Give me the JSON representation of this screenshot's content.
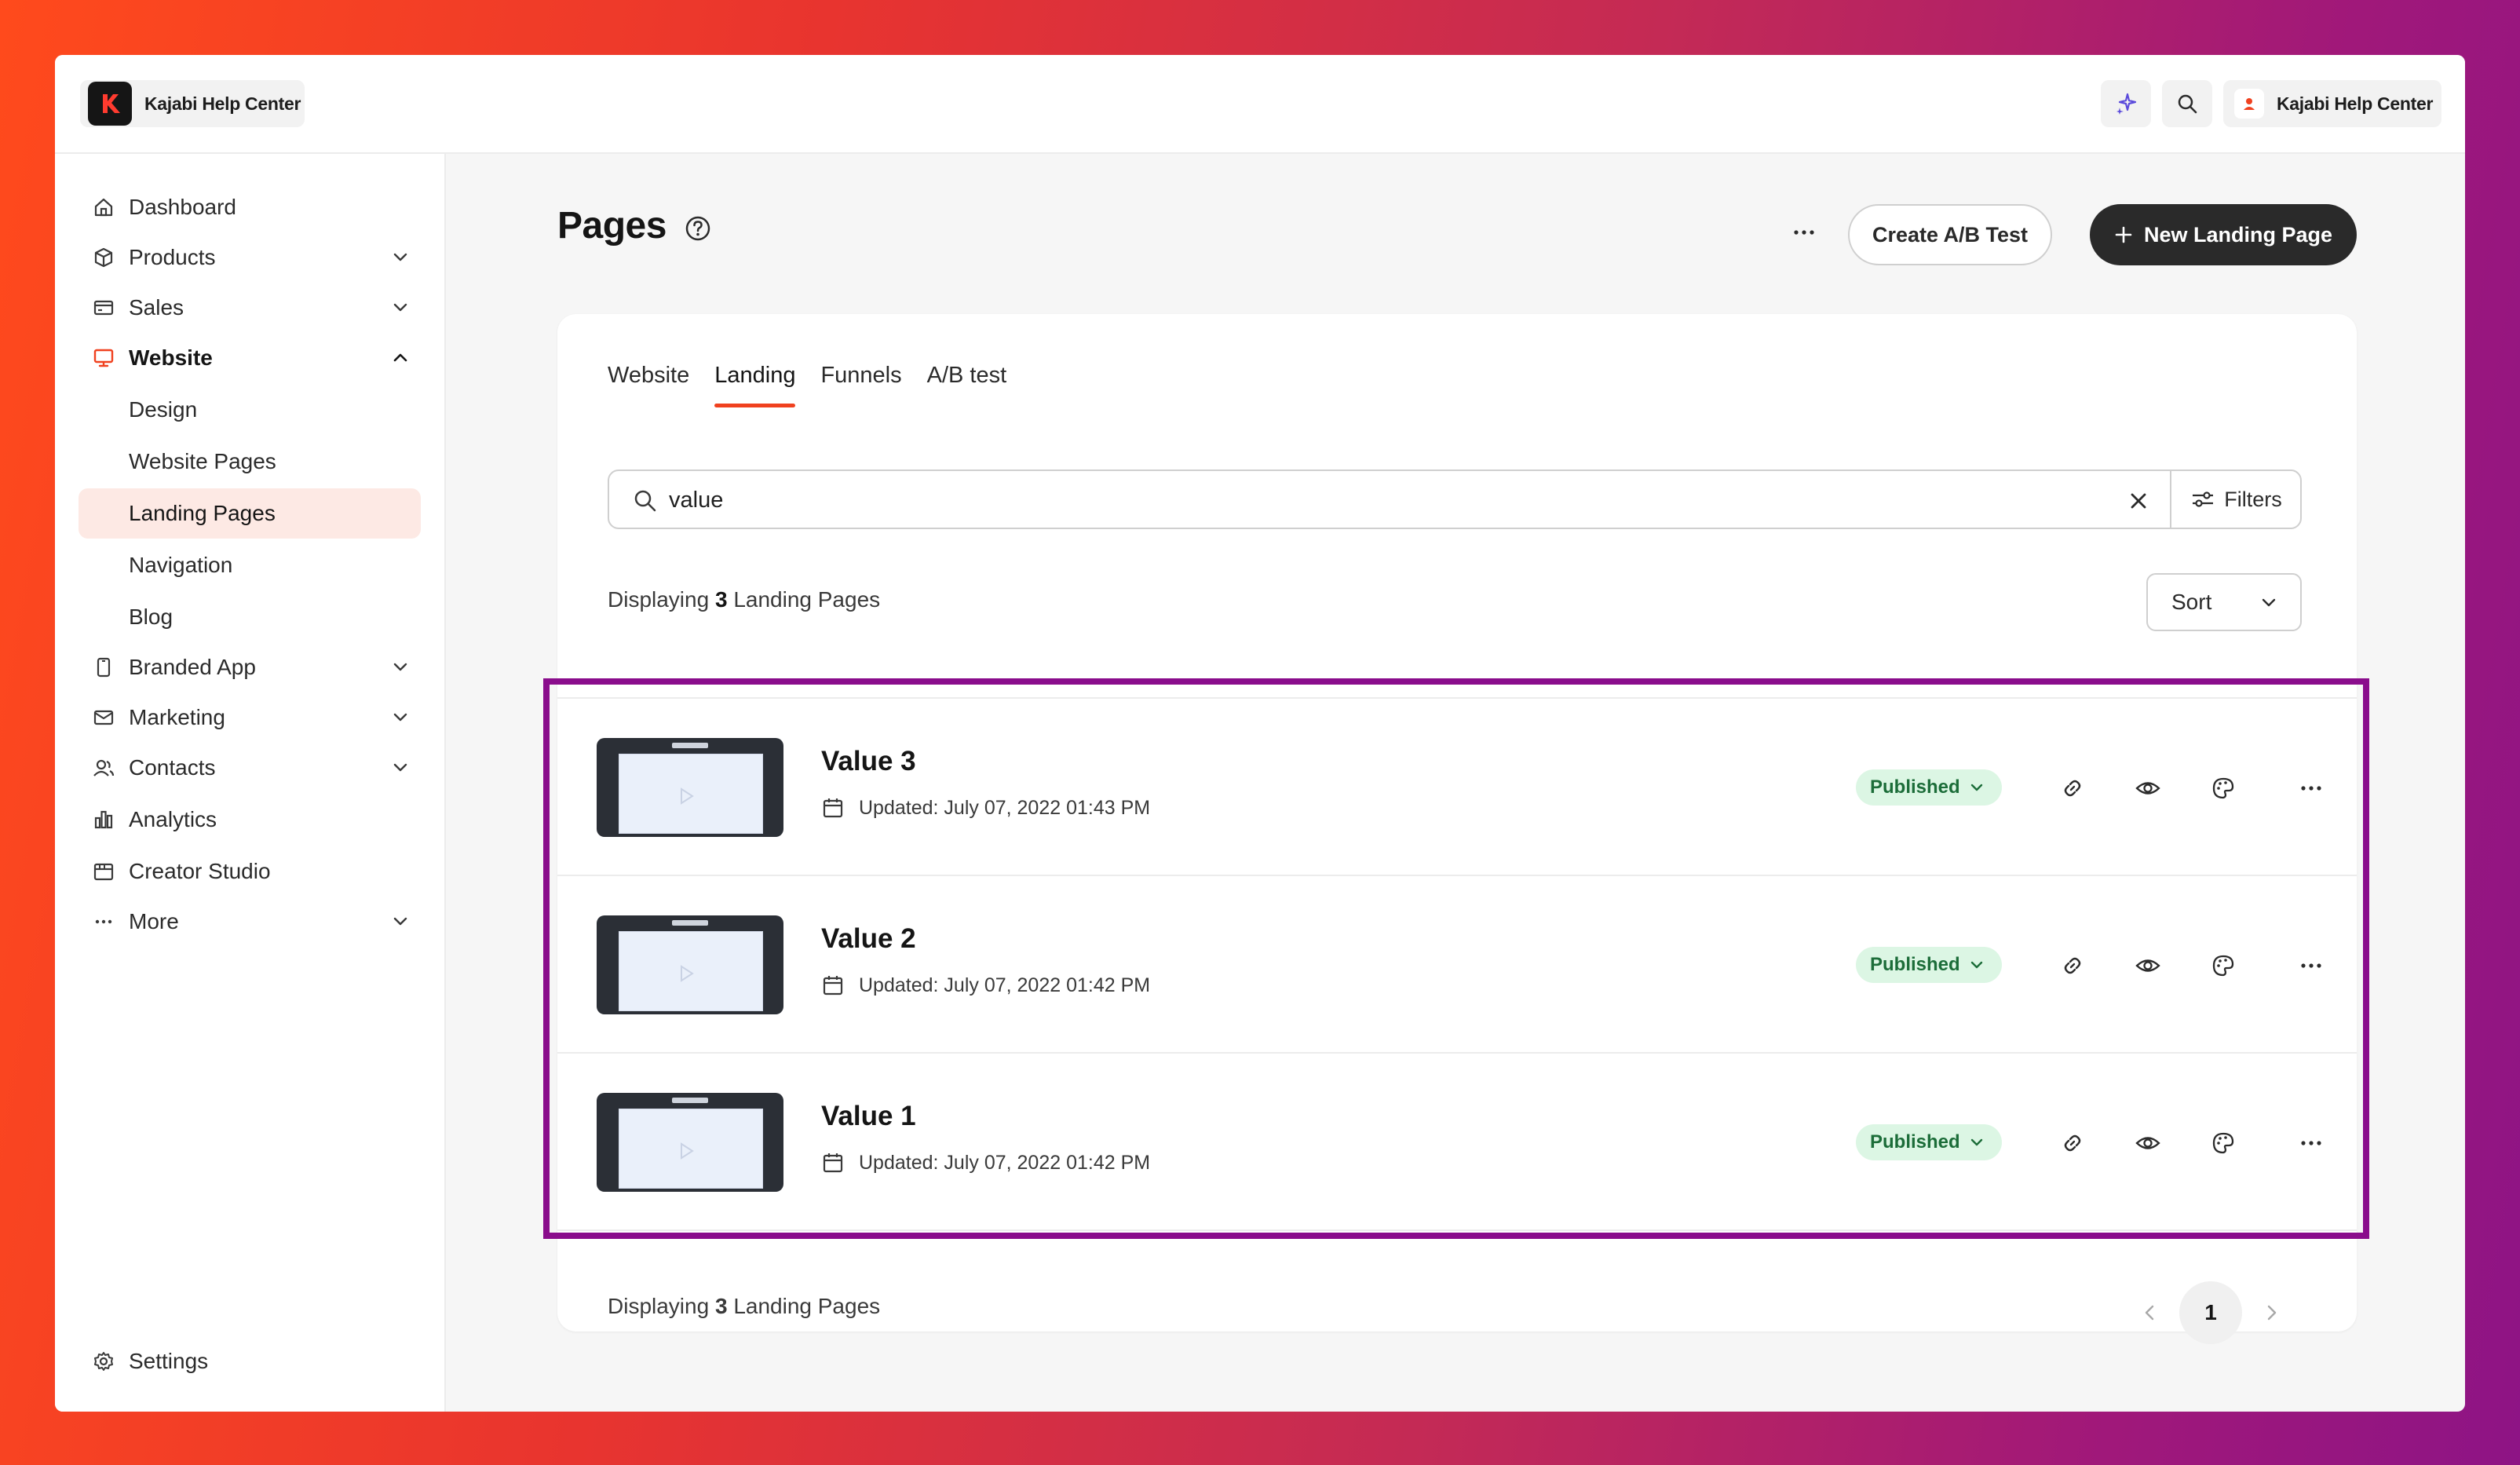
{
  "app": {
    "name": "Kajabi Help Center"
  },
  "header": {
    "user_name": "Kajabi Help Center"
  },
  "sidebar": {
    "items": [
      {
        "label": "Dashboard",
        "icon": "home-icon"
      },
      {
        "label": "Products",
        "icon": "box-icon",
        "expandable": true
      },
      {
        "label": "Sales",
        "icon": "credit-card-icon",
        "expandable": true
      },
      {
        "label": "Website",
        "icon": "monitor-icon",
        "expanded": true
      },
      {
        "label": "Design"
      },
      {
        "label": "Website Pages"
      },
      {
        "label": "Landing Pages",
        "selected": true
      },
      {
        "label": "Navigation"
      },
      {
        "label": "Blog"
      },
      {
        "label": "Branded App",
        "icon": "phone-icon",
        "expandable": true
      },
      {
        "label": "Marketing",
        "icon": "mail-icon",
        "expandable": true
      },
      {
        "label": "Contacts",
        "icon": "people-icon",
        "expandable": true
      },
      {
        "label": "Analytics",
        "icon": "bar-chart-icon"
      },
      {
        "label": "Creator Studio",
        "icon": "calendar-icon"
      },
      {
        "label": "More",
        "icon": "dots-icon",
        "expandable": true
      }
    ],
    "settings_label": "Settings"
  },
  "page": {
    "title": "Pages",
    "create_ab_label": "Create A/B Test",
    "new_landing_label": "New Landing Page"
  },
  "tabs": [
    {
      "label": "Website"
    },
    {
      "label": "Landing",
      "active": true
    },
    {
      "label": "Funnels"
    },
    {
      "label": "A/B test"
    }
  ],
  "search": {
    "value": "value",
    "filters_label": "Filters"
  },
  "summary": {
    "prefix": "Displaying",
    "count": "3",
    "suffix": "Landing Pages"
  },
  "sort_label": "Sort",
  "pages": [
    {
      "title": "Value 3",
      "updated": "Updated: July 07, 2022 01:43 PM",
      "status": "Published"
    },
    {
      "title": "Value 2",
      "updated": "Updated: July 07, 2022 01:42 PM",
      "status": "Published"
    },
    {
      "title": "Value 1",
      "updated": "Updated: July 07, 2022 01:42 PM",
      "status": "Published"
    }
  ],
  "pagination": {
    "current": "1"
  },
  "colors": {
    "accent": "#f0411f",
    "highlight_border": "#8a0d8c",
    "status_bg": "#dcf6e4",
    "status_text": "#1c6d39",
    "primary_button": "#2a2a2a"
  }
}
